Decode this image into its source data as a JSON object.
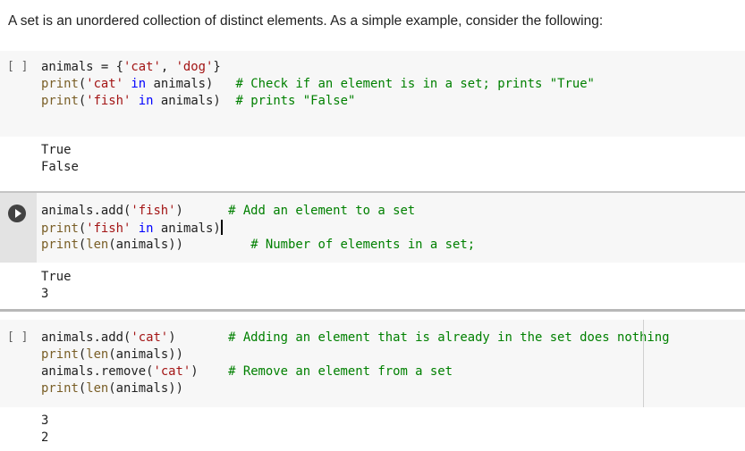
{
  "intro_text": "A set is an unordered collection of distinct elements. As a simple example, consider the following:",
  "cells": [
    {
      "indicator": "[ ]",
      "lines": [
        {
          "parts": [
            [
              "t",
              "animals = {"
            ],
            [
              "str",
              "'cat'"
            ],
            [
              "t",
              ", "
            ],
            [
              "str",
              "'dog'"
            ],
            [
              "t",
              "}"
            ]
          ]
        },
        {
          "parts": [
            [
              "fn",
              "print"
            ],
            [
              "t",
              "("
            ],
            [
              "str",
              "'cat'"
            ],
            [
              "t",
              " "
            ],
            [
              "kw",
              "in"
            ],
            [
              "t",
              " animals)   "
            ],
            [
              "cm",
              "# Check if an element is in a set; prints \"True\""
            ]
          ]
        },
        {
          "parts": [
            [
              "fn",
              "print"
            ],
            [
              "t",
              "("
            ],
            [
              "str",
              "'fish'"
            ],
            [
              "t",
              " "
            ],
            [
              "kw",
              "in"
            ],
            [
              "t",
              " animals)  "
            ],
            [
              "cm",
              "# prints \"False\""
            ]
          ]
        }
      ],
      "output": [
        "True",
        "False"
      ]
    },
    {
      "indicator": "play",
      "lines": [
        {
          "parts": [
            [
              "t",
              "animals.add("
            ],
            [
              "str",
              "'fish'"
            ],
            [
              "t",
              ")      "
            ],
            [
              "cm",
              "# Add an element to a set"
            ]
          ]
        },
        {
          "parts": [
            [
              "fn",
              "print"
            ],
            [
              "t",
              "("
            ],
            [
              "str",
              "'fish'"
            ],
            [
              "t",
              " "
            ],
            [
              "kw",
              "in"
            ],
            [
              "t",
              " animals)"
            ]
          ]
        },
        {
          "parts": [
            [
              "fn",
              "print"
            ],
            [
              "t",
              "("
            ],
            [
              "fn",
              "len"
            ],
            [
              "t",
              "(animals))         "
            ],
            [
              "cm",
              "# Number of elements in a set;"
            ]
          ]
        }
      ],
      "output": [
        "True",
        "3"
      ]
    },
    {
      "indicator": "[ ]",
      "lines": [
        {
          "parts": [
            [
              "t",
              "animals.add("
            ],
            [
              "str",
              "'cat'"
            ],
            [
              "t",
              ")       "
            ],
            [
              "cm",
              "# Adding an element that is already in the set does nothing"
            ]
          ]
        },
        {
          "parts": [
            [
              "fn",
              "print"
            ],
            [
              "t",
              "("
            ],
            [
              "fn",
              "len"
            ],
            [
              "t",
              "(animals))"
            ]
          ]
        },
        {
          "parts": [
            [
              "t",
              "animals.remove("
            ],
            [
              "str",
              "'cat'"
            ],
            [
              "t",
              ")    "
            ],
            [
              "cm",
              "# Remove an element from a set"
            ]
          ]
        },
        {
          "parts": [
            [
              "fn",
              "print"
            ],
            [
              "t",
              "("
            ],
            [
              "fn",
              "len"
            ],
            [
              "t",
              "(animals))"
            ]
          ]
        }
      ],
      "output": [
        "3",
        "2"
      ]
    }
  ]
}
